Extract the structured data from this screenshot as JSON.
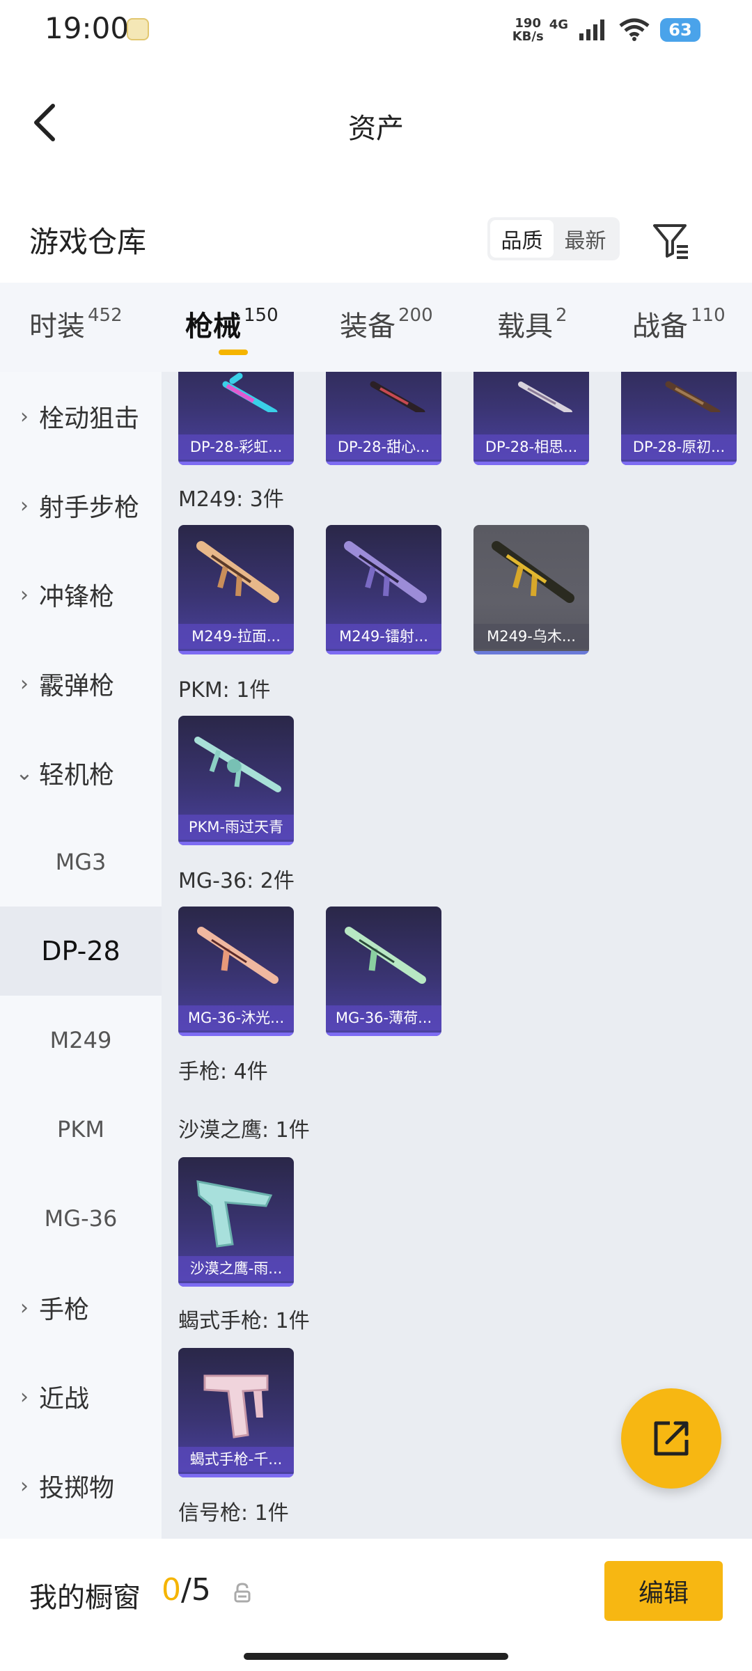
{
  "status_bar": {
    "time": "19:00",
    "net_speed": "190",
    "net_unit": "KB/s",
    "net_type": "4G",
    "battery": "63",
    "icons": [
      "notification-icon",
      "signal-icon",
      "wifi-icon",
      "battery-icon"
    ]
  },
  "header": {
    "title": "资产",
    "back_icon": "chevron-left-icon"
  },
  "warehouse": {
    "title": "游戏仓库",
    "sort_options": [
      "品质",
      "最新"
    ],
    "sort_selected": "品质",
    "filter_icon": "filter-icon"
  },
  "tabs": [
    {
      "label": "时装",
      "count": "452",
      "active": false
    },
    {
      "label": "枪械",
      "count": "150",
      "active": true
    },
    {
      "label": "装备",
      "count": "200",
      "active": false
    },
    {
      "label": "载具",
      "count": "2",
      "active": false
    },
    {
      "label": "战备",
      "count": "110",
      "active": false
    }
  ],
  "sidebar": {
    "categories": [
      {
        "label": "栓动狙击",
        "chevron": "›"
      },
      {
        "label": "射手步枪",
        "chevron": "›"
      },
      {
        "label": "冲锋枪",
        "chevron": "›"
      },
      {
        "label": "霰弹枪",
        "chevron": "›"
      },
      {
        "label": "轻机枪",
        "chevron": "⌄",
        "expanded": true
      }
    ],
    "subitems": [
      {
        "label": "MG3",
        "active": false
      },
      {
        "label": "DP-28",
        "active": true
      },
      {
        "label": "M249",
        "active": false
      },
      {
        "label": "PKM",
        "active": false
      },
      {
        "label": "MG-36",
        "active": false
      }
    ],
    "more_categories": [
      {
        "label": "手枪",
        "chevron": "›"
      },
      {
        "label": "近战",
        "chevron": "›"
      },
      {
        "label": "投掷物",
        "chevron": "›"
      }
    ]
  },
  "content": {
    "groups": [
      {
        "label": "",
        "items": [
          "DP-28-彩虹...",
          "DP-28-甜心...",
          "DP-28-相思...",
          "DP-28-原初..."
        ]
      },
      {
        "label": "M249: 3件",
        "items": [
          "M249-拉面...",
          "M249-镭射...",
          "M249-乌木..."
        ]
      },
      {
        "label": "PKM: 1件",
        "items": [
          "PKM-雨过天青"
        ]
      },
      {
        "label": "MG-36: 2件",
        "items": [
          "MG-36-沐光...",
          "MG-36-薄荷..."
        ]
      },
      {
        "label": "手枪: 4件",
        "items": []
      },
      {
        "label": "沙漠之鹰: 1件",
        "items": [
          "沙漠之鹰-雨..."
        ]
      },
      {
        "label": "蝎式手枪: 1件",
        "items": [
          "蝎式手枪-千..."
        ]
      },
      {
        "label": "信号枪: 1件",
        "items": []
      }
    ]
  },
  "fab": {
    "icon": "share-external-icon"
  },
  "bottom_bar": {
    "title": "我的橱窗",
    "count_current": "0",
    "count_sep": "/",
    "count_total": "5",
    "lock_icon": "lock-icon",
    "edit_label": "编辑"
  },
  "colors": {
    "accent": "#f5b400",
    "card_purple": "#3a3472",
    "card_gray": "#5a5a62"
  }
}
